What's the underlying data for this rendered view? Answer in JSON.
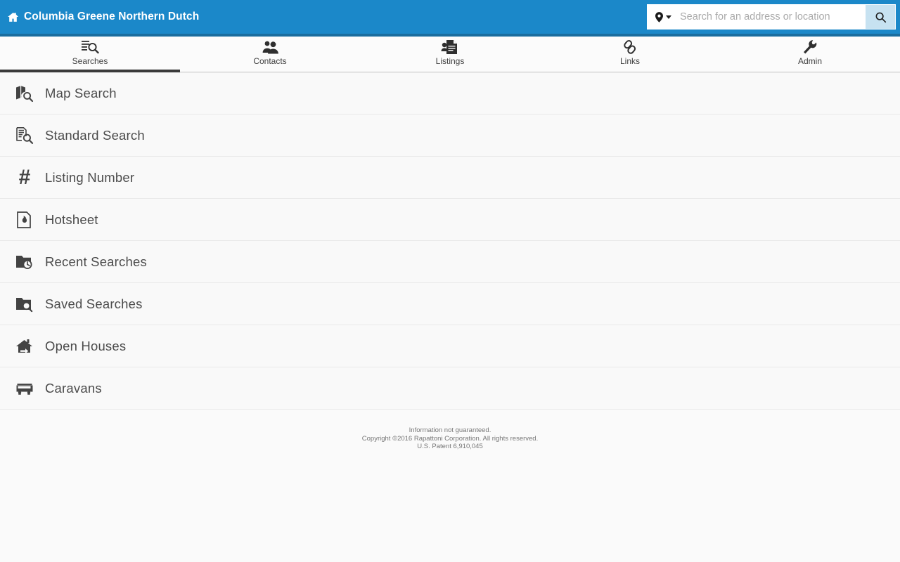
{
  "header": {
    "home_icon": "home-icon",
    "title": "Columbia Greene Northern Dutch",
    "brand_color": "#1b88c9",
    "strip_color": "#1a6d9e",
    "search": {
      "pin_icon": "map-pin-icon",
      "caret_icon": "chevron-down-icon",
      "placeholder": "Search for an address or location",
      "value": "",
      "button_icon": "search-icon",
      "button_color": "#c7e2f1"
    }
  },
  "tabs": [
    {
      "label": "Searches",
      "icon": "document-search-icon",
      "active": true
    },
    {
      "label": "Contacts",
      "icon": "people-icon",
      "active": false
    },
    {
      "label": "Listings",
      "icon": "listing-document-icon",
      "active": false
    },
    {
      "label": "Links",
      "icon": "chain-link-icon",
      "active": false
    },
    {
      "label": "Admin",
      "icon": "wrench-icon",
      "active": false
    }
  ],
  "menu": {
    "items": [
      {
        "label": "Map Search",
        "icon": "map-search-icon"
      },
      {
        "label": "Standard Search",
        "icon": "document-search-icon"
      },
      {
        "label": "Listing Number",
        "icon": "hash-icon"
      },
      {
        "label": "Hotsheet",
        "icon": "flame-document-icon"
      },
      {
        "label": "Recent Searches",
        "icon": "folder-clock-icon"
      },
      {
        "label": "Saved Searches",
        "icon": "folder-search-icon"
      },
      {
        "label": "Open Houses",
        "icon": "open-house-icon"
      },
      {
        "label": "Caravans",
        "icon": "bus-icon"
      }
    ]
  },
  "footer": {
    "line1": "Information not guaranteed.",
    "line2": "Copyright ©2016 Rapattoni Corporation. All rights reserved.",
    "line3": "U.S. Patent 6,910,045"
  }
}
